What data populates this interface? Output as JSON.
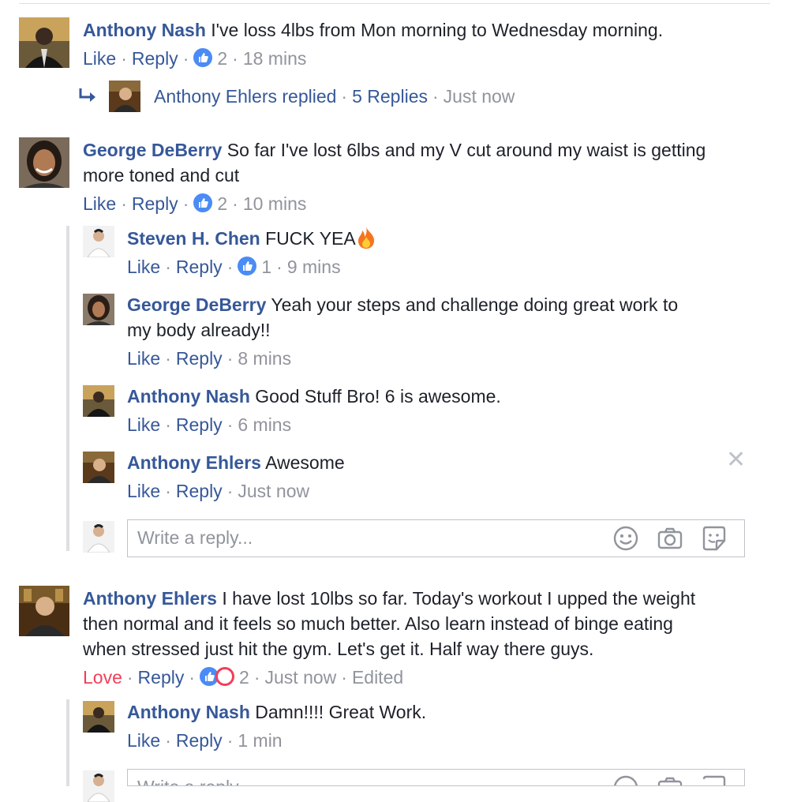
{
  "comments": [
    {
      "author": "Anthony Nash",
      "text": " I've loss 4lbs from Mon morning to Wednesday morning.",
      "reaction_label": "Like",
      "reply_label": "Reply",
      "reaction_count": "2",
      "time": "18 mins",
      "replied_summary": {
        "author_action": "Anthony Ehlers replied",
        "replies_count": "5 Replies",
        "time": "Just now"
      }
    },
    {
      "author": "George DeBerry",
      "text_line1": " So far I've lost 6lbs and my V cut around my waist is getting",
      "text_line2": "more toned and cut",
      "reaction_label": "Like",
      "reply_label": "Reply",
      "reaction_count": "2",
      "time": "10 mins",
      "replies": [
        {
          "author": "Steven H. Chen",
          "text": " FUCK YEA",
          "reaction_label": "Like",
          "reply_label": "Reply",
          "reaction_count": "1",
          "time": "9 mins"
        },
        {
          "author": "George DeBerry",
          "text_line1": " Yeah your steps and challenge doing great work to",
          "text_line2": "my body already!!",
          "reaction_label": "Like",
          "reply_label": "Reply",
          "time": "8 mins"
        },
        {
          "author": "Anthony Nash",
          "text": " Good Stuff Bro! 6 is awesome.",
          "reaction_label": "Like",
          "reply_label": "Reply",
          "time": "6 mins"
        },
        {
          "author": "Anthony Ehlers",
          "text": " Awesome",
          "reaction_label": "Like",
          "reply_label": "Reply",
          "time": "Just now"
        }
      ],
      "reply_input_placeholder": "Write a reply..."
    },
    {
      "author": "Anthony Ehlers",
      "text_line1": " I have lost 10lbs so far. Today's workout I upped the weight",
      "text_line2": "then normal and it feels so much better. Also learn instead of binge eating",
      "text_line3": "when stressed just hit the gym. Let's get it. Half way there guys.",
      "reaction_label": "Love",
      "reply_label": "Reply",
      "reaction_count": "2",
      "time": "Just now",
      "edited_label": "Edited",
      "replies": [
        {
          "author": "Anthony Nash",
          "text": " Damn!!!! Great Work.",
          "reaction_label": "Like",
          "reply_label": "Reply",
          "time": "1 min"
        }
      ],
      "reply_input_placeholder": "Write a reply..."
    }
  ],
  "separator": "·",
  "close_glyph": "✕",
  "colors": {
    "link": "#365899",
    "meta": "#90949c",
    "love": "#f33e58",
    "like_badge": "#4b8bf5",
    "thread_line": "#dddfe2"
  },
  "icons": [
    "emoji-icon",
    "camera-icon",
    "sticker-icon",
    "reply-arrow-icon",
    "like-reaction-icon",
    "love-reaction-icon",
    "fire-emoji-icon",
    "close-icon"
  ]
}
